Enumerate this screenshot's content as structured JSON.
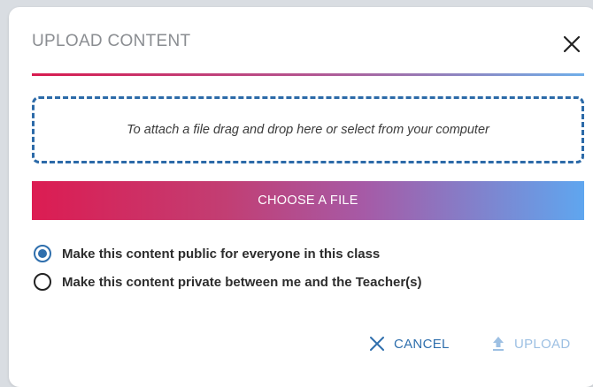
{
  "dialog": {
    "title": "UPLOAD CONTENT",
    "close_icon": "close-icon"
  },
  "dropzone": {
    "text": "To attach a file drag and drop here or select from your computer"
  },
  "choose_button": {
    "label": "CHOOSE A FILE"
  },
  "visibility_options": [
    {
      "label": "Make this content public for everyone in this class",
      "selected": true
    },
    {
      "label": "Make this content private between me and the Teacher(s)",
      "selected": false
    }
  ],
  "actions": {
    "cancel_label": "CANCEL",
    "cancel_icon": "close-icon",
    "upload_label": "UPLOAD",
    "upload_icon": "upload-icon",
    "upload_enabled": false
  },
  "colors": {
    "accent": "#2f6fad",
    "gradient_start": "#dc1c52",
    "gradient_end": "#5fa6ef",
    "disabled": "#9dc0e3"
  }
}
